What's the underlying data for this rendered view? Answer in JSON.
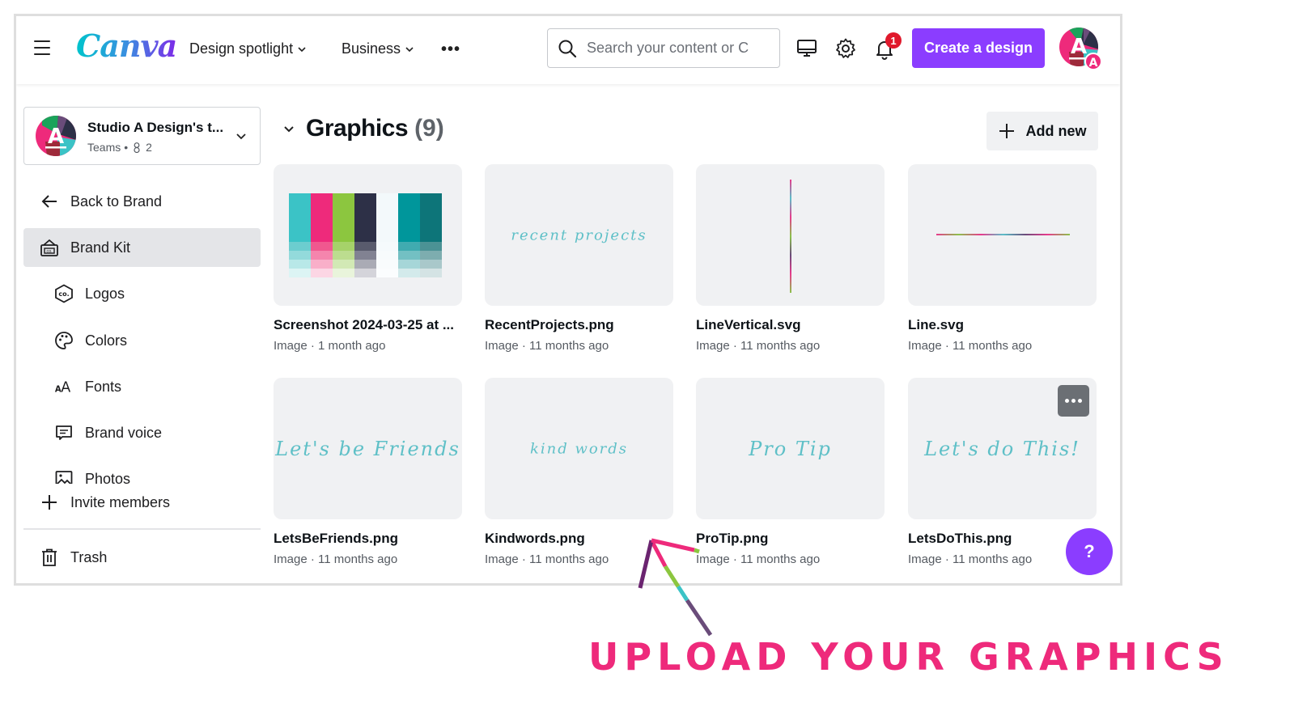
{
  "topbar": {
    "logo": "Canva",
    "nav": [
      {
        "label": "Design spotlight"
      },
      {
        "label": "Business"
      }
    ],
    "more_label": "•••",
    "search_placeholder": "Search your content or Canva's",
    "notification_count": "1",
    "create_label": "Create a design",
    "icons": [
      "menu-icon",
      "search-icon",
      "desktop-icon",
      "gear-icon",
      "bell-icon"
    ]
  },
  "sidebar": {
    "team": {
      "name": "Studio A Design's t...",
      "plan": "Teams",
      "members": "2"
    },
    "back_label": "Back to Brand",
    "brand_kit_label": "Brand Kit",
    "items": [
      {
        "label": "Logos",
        "icon": "logo-hexagon-icon"
      },
      {
        "label": "Colors",
        "icon": "palette-icon"
      },
      {
        "label": "Fonts",
        "icon": "fonts-icon"
      },
      {
        "label": "Brand voice",
        "icon": "message-icon"
      },
      {
        "label": "Photos",
        "icon": "image-icon"
      }
    ],
    "invite_label": "Invite members",
    "trash_label": "Trash"
  },
  "main": {
    "section_title": "Graphics",
    "section_count": "(9)",
    "add_new_label": "Add new",
    "cards": [
      {
        "title": "Screenshot 2024-03-25 at ...",
        "type": "Image",
        "age": "1 month ago",
        "preview": "palette"
      },
      {
        "title": "RecentProjects.png",
        "type": "Image",
        "age": "11 months ago",
        "preview": "recent projects"
      },
      {
        "title": "LineVertical.svg",
        "type": "Image",
        "age": "11 months ago",
        "preview": "vline"
      },
      {
        "title": "Line.svg",
        "type": "Image",
        "age": "11 months ago",
        "preview": "hline"
      },
      {
        "title": "LetsBeFriends.png",
        "type": "Image",
        "age": "11 months ago",
        "preview": "Let's be Friends"
      },
      {
        "title": "Kindwords.png",
        "type": "Image",
        "age": "11 months ago",
        "preview": "kind words"
      },
      {
        "title": "ProTip.png",
        "type": "Image",
        "age": "11 months ago",
        "preview": "Pro Tip"
      },
      {
        "title": "LetsDoThis.png",
        "type": "Image",
        "age": "11 months ago",
        "preview": "Let's do This!"
      }
    ],
    "palette_colors": [
      {
        "base": "#3bc3c6",
        "tints": [
          "#6ccdcf",
          "#93dadb",
          "#b8e8e8",
          "#dcf4f4"
        ]
      },
      {
        "base": "#ee2a7b",
        "tints": [
          "#f0588f",
          "#f585ad",
          "#f9afc9",
          "#fcd6e4"
        ]
      },
      {
        "base": "#8cc63f",
        "tints": [
          "#a6d26a",
          "#bcdd8f",
          "#d2e9b5",
          "#e9f4db"
        ]
      },
      {
        "base": "#2d3047",
        "tints": [
          "#595b6d",
          "#818292",
          "#aaabb5",
          "#d4d4da"
        ]
      },
      {
        "base": "#f3f9fb",
        "tints": [
          "#f5fafc",
          "#f7fbfc",
          "#f9fcfd",
          "#fbfdfe"
        ]
      },
      {
        "base": "#00969b",
        "tints": [
          "#40abb0",
          "#73c0c3",
          "#a6d6d8",
          "#d3eaeb"
        ]
      },
      {
        "base": "#0d7579",
        "tints": [
          "#4b9295",
          "#7dadaf",
          "#a9c8ca",
          "#d4e3e4"
        ]
      }
    ],
    "help_label": "?"
  },
  "annotation": {
    "text": "UPLOAD YOUR GRAPHICS",
    "color": "#ee2a7b"
  },
  "colors": {
    "accent": "#8b3dff",
    "badge": "#e0192c",
    "script_teal": "#46b8c0"
  }
}
